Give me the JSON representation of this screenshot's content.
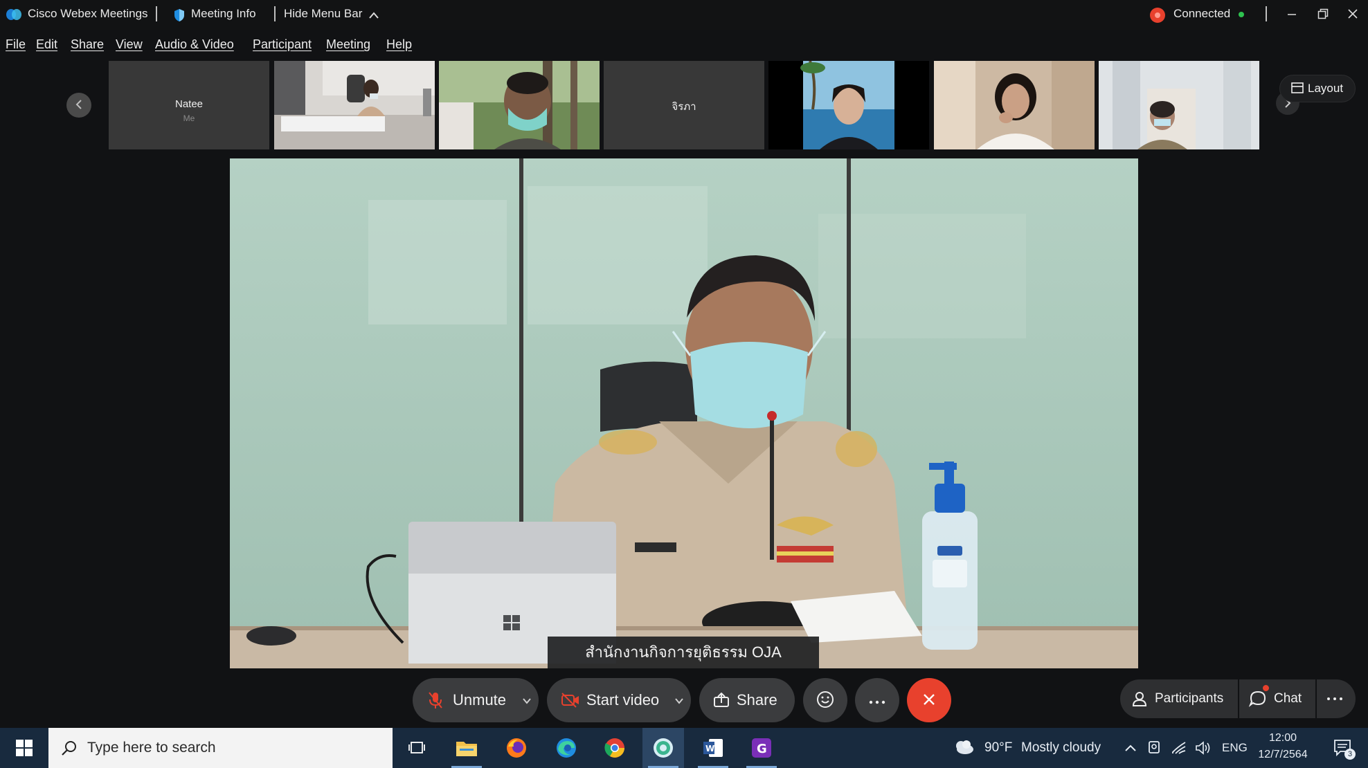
{
  "titlebar": {
    "app_name": "Cisco Webex Meetings",
    "meeting_info": "Meeting Info",
    "hide_menu_bar": "Hide Menu Bar",
    "connection_status": "Connected"
  },
  "menu": [
    "File",
    "Edit",
    "Share",
    "View",
    "Audio & Video",
    "Participant",
    "Meeting",
    "Help"
  ],
  "filmstrip": {
    "tiles": [
      {
        "name": "Natee",
        "sub": "Me",
        "type": "avatar"
      },
      {
        "name": "",
        "sub": "",
        "type": "video"
      },
      {
        "name": "",
        "sub": "",
        "type": "video"
      },
      {
        "name": "จิรภา",
        "sub": "",
        "type": "avatar"
      },
      {
        "name": "",
        "sub": "",
        "type": "video"
      },
      {
        "name": "",
        "sub": "",
        "type": "video"
      },
      {
        "name": "",
        "sub": "",
        "type": "video"
      }
    ],
    "layout_label": "Layout"
  },
  "main_video": {
    "caption": "สำนักงานกิจการยุติธรรม OJA"
  },
  "controls": {
    "unmute": "Unmute",
    "start_video": "Start video",
    "share": "Share",
    "participants": "Participants",
    "chat": "Chat"
  },
  "taskbar": {
    "search_placeholder": "Type here to search",
    "weather_temp": "90°F",
    "weather_desc": "Mostly cloudy",
    "language": "ENG",
    "time": "12:00",
    "date": "12/7/2564",
    "notification_count": "3"
  },
  "colors": {
    "end_call": "#e8412d",
    "connected_dot": "#2ec24f",
    "recording": "#e8412d"
  }
}
